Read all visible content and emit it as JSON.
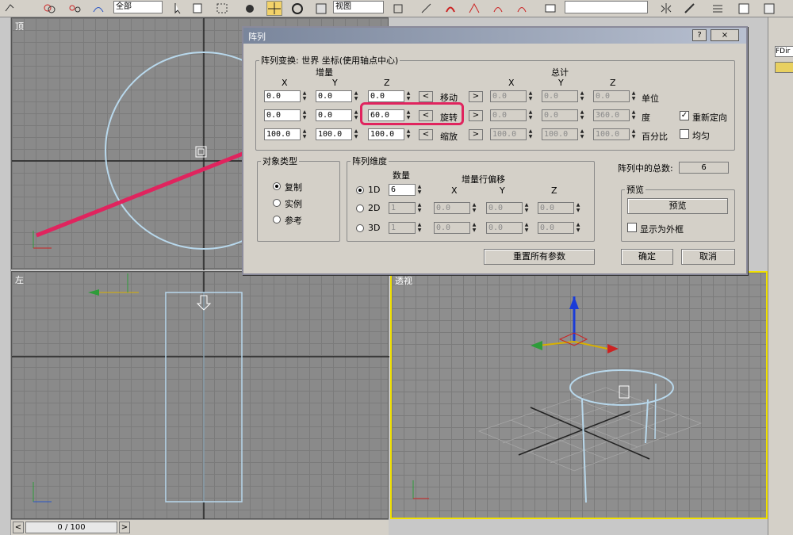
{
  "toolbar": {
    "select_all": "全部",
    "view": "视图"
  },
  "viewports": {
    "top_label": "顶",
    "left_label": "左",
    "persp_label": "透视"
  },
  "timeline": {
    "frame": "0 / 100"
  },
  "dialog": {
    "title": "阵列",
    "help_btn": "?",
    "close_btn": "×",
    "transform_legend": "阵列变换: 世界 坐标(使用轴点中心)",
    "increment": "增量",
    "total": "总计",
    "axes": [
      "X",
      "Y",
      "Z"
    ],
    "rows": [
      {
        "label": "移动",
        "unit": "单位",
        "inc": [
          "0.0",
          "0.0",
          "0.0"
        ],
        "tot": [
          "0.0",
          "0.0",
          "0.0"
        ]
      },
      {
        "label": "旋转",
        "unit": "度",
        "inc": [
          "0.0",
          "0.0",
          "60.0"
        ],
        "tot": [
          "0.0",
          "0.0",
          "360.0"
        ]
      },
      {
        "label": "缩放",
        "unit": "百分比",
        "inc": [
          "100.0",
          "100.0",
          "100.0"
        ],
        "tot": [
          "100.0",
          "100.0",
          "100.0"
        ]
      }
    ],
    "reorient": "重新定向",
    "reorient_checked": true,
    "uniform": "均匀",
    "object_type": {
      "legend": "对象类型",
      "options": [
        "复制",
        "实例",
        "参考"
      ],
      "selected": 0
    },
    "dimensions": {
      "legend": "阵列维度",
      "count_header": "数量",
      "offset_header": "增量行偏移",
      "rows": [
        {
          "label": "1D",
          "count": "6"
        },
        {
          "label": "2D",
          "count": "1",
          "offset": [
            "0.0",
            "0.0",
            "0.0"
          ]
        },
        {
          "label": "3D",
          "count": "1",
          "offset": [
            "0.0",
            "0.0",
            "0.0"
          ]
        }
      ]
    },
    "total_label": "阵列中的总数:",
    "total_value": "6",
    "preview_legend": "预览",
    "preview_btn": "预览",
    "show_as_box": "显示为外框",
    "reset_btn": "重置所有参数",
    "ok_btn": "确定",
    "cancel_btn": "取消"
  },
  "right_panel": {
    "name_field": "FDir"
  }
}
